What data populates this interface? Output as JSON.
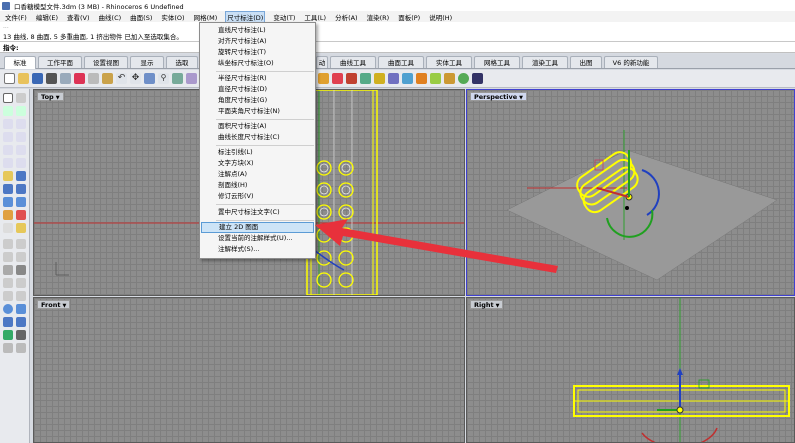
{
  "window": {
    "title": "口香糖模型文件.3dm (3 MB) - Rhinoceros 6 Undefined"
  },
  "menubar": {
    "items": [
      "文件(F)",
      "编辑(E)",
      "查看(V)",
      "曲线(C)",
      "曲面(S)",
      "实体(O)",
      "网格(M)",
      "尺寸标注(D)",
      "变动(T)",
      "工具(L)",
      "分析(A)",
      "渲染(R)",
      "面板(P)",
      "说明(H)"
    ]
  },
  "history": {
    "line1": "...",
    "line2": "13 曲线, 8 曲面, 5 多重曲面, 1 挤出物件 已加入至选取集合。"
  },
  "command": {
    "prompt": "指令:"
  },
  "tabs": [
    "标准",
    "工作平面",
    "设置视图",
    "显示",
    "选取",
    "动",
    "曲线工具",
    "曲面工具",
    "实体工具",
    "网格工具",
    "渲染工具",
    "出图",
    "V6 的新功能"
  ],
  "dropdown": {
    "items": [
      "直线尺寸标注(L)",
      "对齐尺寸标注(A)",
      "旋转尺寸标注(T)",
      "纵坐标尺寸标注(O)",
      "半径尺寸标注(R)",
      "直径尺寸标注(D)",
      "角度尺寸标注(G)",
      "平面夹角尺寸标注(N)",
      "面积尺寸标注(A)",
      "曲线长度尺寸标注(C)",
      "标注引线(L)",
      "文字方块(X)",
      "注解点(A)",
      "剖面线(H)",
      "修订云形(V)",
      "置中尺寸标注文字(C)",
      "建立 2D 图面",
      "设置当前的注解样式(U)...",
      "注解样式(S)..."
    ],
    "highlighted": "建立 2D 图面"
  },
  "viewports": {
    "top": {
      "label": "Top"
    },
    "perspective": {
      "label": "Perspective"
    },
    "front": {
      "label": "Front"
    },
    "right": {
      "label": "Right"
    }
  },
  "colors": {
    "highlight": "#cde4f7",
    "arrow": "#e8313b",
    "selection": "#ffff00",
    "viewport_bg": "#8d8d8d"
  }
}
